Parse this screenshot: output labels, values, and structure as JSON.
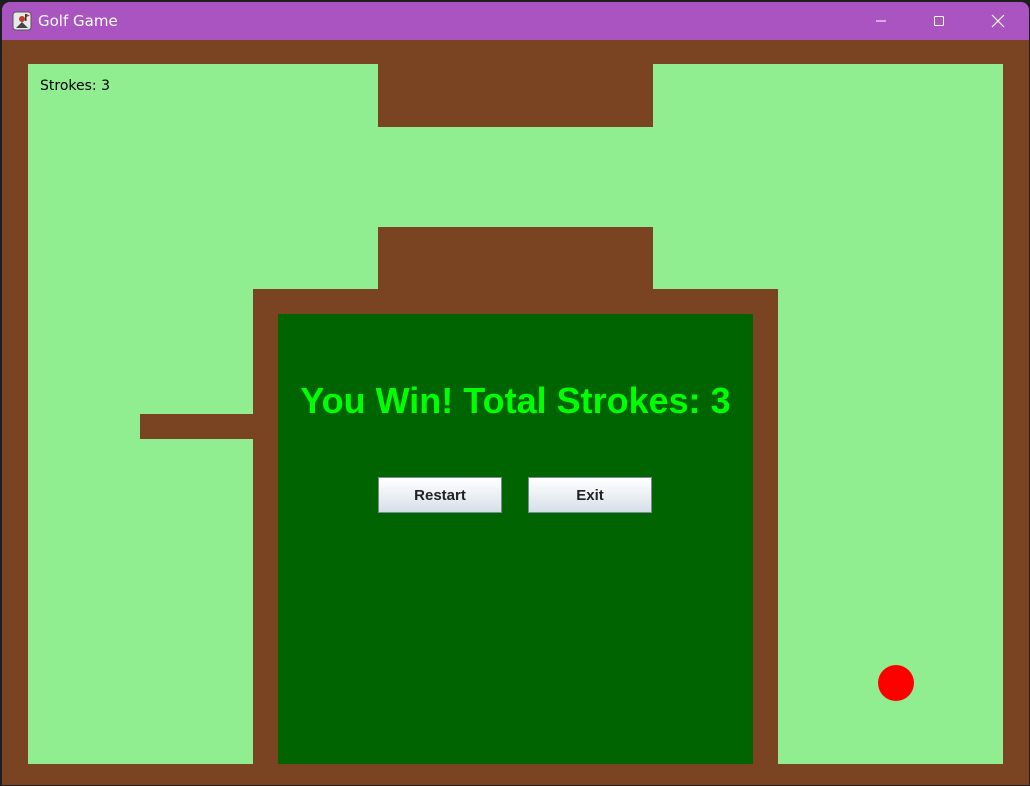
{
  "window": {
    "title": "Golf Game",
    "icon": "golf-game-app-icon",
    "controls": {
      "minimize_icon": "minimize-icon",
      "maximize_icon": "maximize-icon",
      "close_icon": "close-icon"
    }
  },
  "game": {
    "strokes_label": "Strokes: 3",
    "win_message": "You Win! Total Strokes: 3",
    "restart_label": "Restart",
    "exit_label": "Exit",
    "colors": {
      "titlebar": "#a954c1",
      "wall": "#7a4422",
      "grass": "#90ee90",
      "win_panel": "#006400",
      "win_text": "#00ff00",
      "ball": "#ff0000"
    }
  }
}
